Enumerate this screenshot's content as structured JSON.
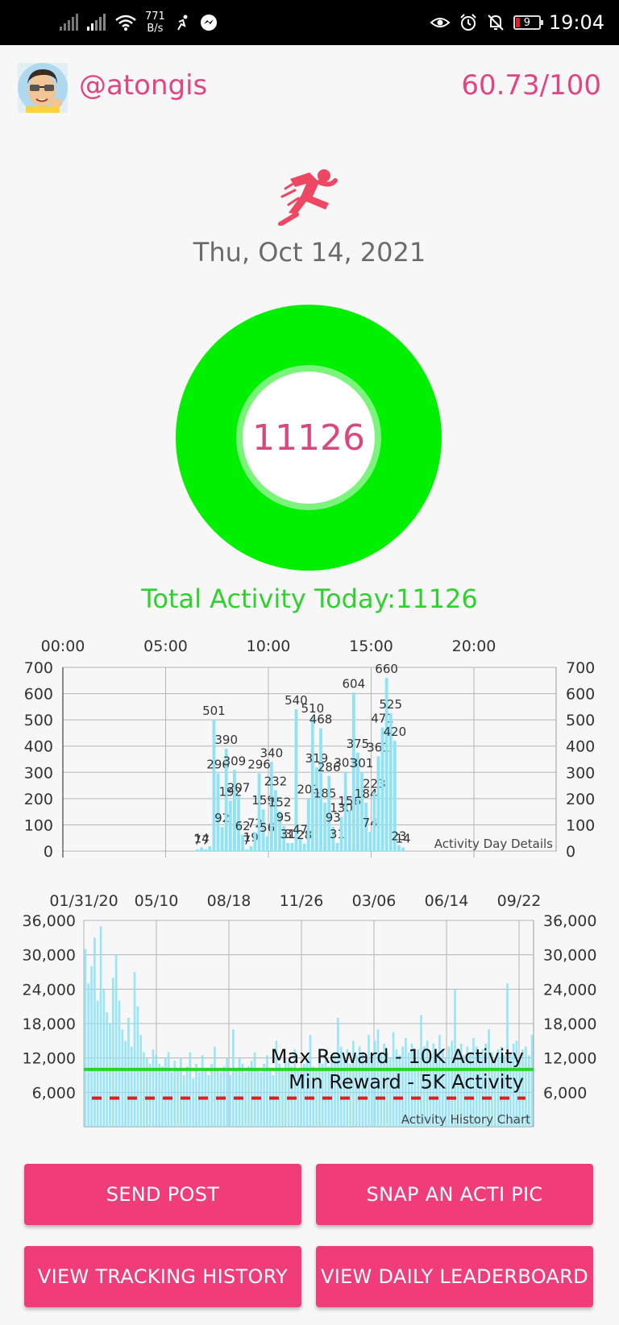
{
  "status_bar": {
    "net_speed_value": "771",
    "net_speed_unit": "B/s",
    "battery_level": "9",
    "time": "19:04"
  },
  "header": {
    "username": "@atongis",
    "score": "60.73/100"
  },
  "date": "Thu, Oct 14, 2021",
  "activity_ring": {
    "value": "11126",
    "ring_color": "#00f000",
    "inner_ring_color": "#7bf47b"
  },
  "total_activity_text": "Total Activity Today:11126",
  "colors": {
    "accent_pink": "#e2457f",
    "button_pink": "#f03c79",
    "bar_blue": "#8fe3f7",
    "max_line_green": "#22d822",
    "min_line_red": "#d82020"
  },
  "chart_data": [
    {
      "type": "bar",
      "caption": "Activity Day Details",
      "x_tick_labels": [
        "00:00",
        "05:00",
        "10:00",
        "15:00",
        "20:00"
      ],
      "x_tick_hours": [
        0,
        5,
        10,
        15,
        20
      ],
      "xlim_hours": [
        0,
        24
      ],
      "ylim": [
        0,
        700
      ],
      "y_ticks": [
        0,
        100,
        200,
        300,
        400,
        500,
        600,
        700
      ],
      "grid": true,
      "bars": [
        {
          "hour": 6.55,
          "value": 7,
          "label": "7"
        },
        {
          "hour": 6.75,
          "value": 14,
          "label": "14"
        },
        {
          "hour": 6.95,
          "value": 7,
          "label": "7"
        },
        {
          "hour": 7.15,
          "value": 18,
          "label": ""
        },
        {
          "hour": 7.35,
          "value": 501,
          "label": "501"
        },
        {
          "hour": 7.55,
          "value": 296,
          "label": "296"
        },
        {
          "hour": 7.75,
          "value": 92,
          "label": "92"
        },
        {
          "hour": 7.95,
          "value": 390,
          "label": "390"
        },
        {
          "hour": 8.15,
          "value": 192,
          "label": "192"
        },
        {
          "hour": 8.35,
          "value": 309,
          "label": "309"
        },
        {
          "hour": 8.55,
          "value": 207,
          "label": "207"
        },
        {
          "hour": 8.75,
          "value": 62,
          "label": "62"
        },
        {
          "hour": 8.95,
          "value": 7,
          "label": "7"
        },
        {
          "hour": 9.15,
          "value": 19,
          "label": "19"
        },
        {
          "hour": 9.35,
          "value": 72,
          "label": "72"
        },
        {
          "hour": 9.55,
          "value": 296,
          "label": "296"
        },
        {
          "hour": 9.75,
          "value": 159,
          "label": "159"
        },
        {
          "hour": 9.95,
          "value": 56,
          "label": "56"
        },
        {
          "hour": 10.15,
          "value": 340,
          "label": "340"
        },
        {
          "hour": 10.35,
          "value": 232,
          "label": "232"
        },
        {
          "hour": 10.55,
          "value": 152,
          "label": "152"
        },
        {
          "hour": 10.75,
          "value": 95,
          "label": "95"
        },
        {
          "hour": 10.95,
          "value": 31,
          "label": "31"
        },
        {
          "hour": 11.15,
          "value": 31,
          "label": "31"
        },
        {
          "hour": 11.35,
          "value": 540,
          "label": "540"
        },
        {
          "hour": 11.55,
          "value": 47,
          "label": "47"
        },
        {
          "hour": 11.75,
          "value": 28,
          "label": "28"
        },
        {
          "hour": 11.95,
          "value": 201,
          "label": "201"
        },
        {
          "hour": 12.15,
          "value": 510,
          "label": "510"
        },
        {
          "hour": 12.35,
          "value": 319,
          "label": "319"
        },
        {
          "hour": 12.55,
          "value": 468,
          "label": "468"
        },
        {
          "hour": 12.75,
          "value": 185,
          "label": "185"
        },
        {
          "hour": 12.95,
          "value": 286,
          "label": "286"
        },
        {
          "hour": 13.15,
          "value": 93,
          "label": "93"
        },
        {
          "hour": 13.35,
          "value": 31,
          "label": "31"
        },
        {
          "hour": 13.55,
          "value": 130,
          "label": "130"
        },
        {
          "hour": 13.75,
          "value": 303,
          "label": "303"
        },
        {
          "hour": 13.95,
          "value": 156,
          "label": "156"
        },
        {
          "hour": 14.15,
          "value": 604,
          "label": "604"
        },
        {
          "hour": 14.35,
          "value": 375,
          "label": "375"
        },
        {
          "hour": 14.55,
          "value": 301,
          "label": "301"
        },
        {
          "hour": 14.75,
          "value": 184,
          "label": "184"
        },
        {
          "hour": 14.95,
          "value": 74,
          "label": "74"
        },
        {
          "hour": 15.15,
          "value": 223,
          "label": "223"
        },
        {
          "hour": 15.35,
          "value": 361,
          "label": "361"
        },
        {
          "hour": 15.55,
          "value": 471,
          "label": "471"
        },
        {
          "hour": 15.75,
          "value": 660,
          "label": "660"
        },
        {
          "hour": 15.95,
          "value": 525,
          "label": "525"
        },
        {
          "hour": 16.15,
          "value": 420,
          "label": "420"
        },
        {
          "hour": 16.35,
          "value": 23,
          "label": "23"
        },
        {
          "hour": 16.55,
          "value": 14,
          "label": "14"
        }
      ]
    },
    {
      "type": "bar",
      "caption": "Activity History Chart",
      "x_tick_labels": [
        "01/31/20",
        "05/10",
        "08/18",
        "11/26",
        "03/06",
        "06/14",
        "09/22"
      ],
      "x_days_span": [
        0,
        620
      ],
      "x_tick_days": [
        0,
        100,
        200,
        300,
        400,
        500,
        600
      ],
      "ylim": [
        0,
        36000
      ],
      "y_ticks": [
        6000,
        12000,
        18000,
        24000,
        30000,
        36000
      ],
      "y_tick_labels": [
        "6,000",
        "12,000",
        "18,000",
        "24,000",
        "30,000",
        "36,000"
      ],
      "grid": true,
      "reference_lines": [
        {
          "label": "Max Reward - 10K Activity",
          "value": 10000,
          "color": "#22d822",
          "style": "solid"
        },
        {
          "label": "Min Reward - 5K Activity",
          "value": 5000,
          "color": "#d82020",
          "style": "dashed"
        }
      ],
      "daily_values": [
        31000,
        25000,
        28000,
        33000,
        22000,
        35000,
        24000,
        20000,
        18000,
        26000,
        30000,
        22000,
        17000,
        15000,
        19000,
        14000,
        27000,
        21000,
        16000,
        13000,
        12000,
        11000,
        13500,
        12500,
        11000,
        10500,
        12000,
        13000,
        9500,
        11500,
        10000,
        12000,
        9000,
        10500,
        13000,
        8500,
        11000,
        9500,
        12500,
        10000,
        9000,
        11000,
        14000,
        10000,
        9500,
        10500,
        12000,
        9000,
        17000,
        10000,
        12000,
        11000,
        9500,
        10500,
        11500,
        13000,
        10000,
        9500,
        11000,
        12500,
        10000,
        9000,
        15000,
        11000,
        10000,
        12000,
        11500,
        10500,
        13500,
        10000,
        9500,
        11000,
        12000,
        16000,
        10500,
        10000,
        12000,
        11000,
        13000,
        10500,
        11500,
        12500,
        19000,
        14000,
        12000,
        13500,
        11000,
        15000,
        12500,
        14000,
        13000,
        11500,
        16000,
        12000,
        15000,
        17000,
        12500,
        14500,
        13000,
        12000,
        16500,
        13500,
        12500,
        14000,
        15500,
        13000,
        14500,
        12000,
        13500,
        19500,
        14000,
        15000,
        12500,
        14500,
        13000,
        16000,
        13500,
        12000,
        14000,
        15000,
        24000,
        13000,
        14500,
        12500,
        14000,
        13000,
        15500,
        14000,
        12500,
        13500,
        14500,
        17000,
        13000,
        12000,
        13500,
        14000,
        12500,
        25000,
        13000,
        14500,
        15000,
        12000,
        13500,
        14000,
        12500,
        16000
      ]
    }
  ],
  "buttons": {
    "send_post": "SEND POST",
    "snap_pic": "SNAP AN ACTI PIC",
    "tracking_history": "VIEW TRACKING HISTORY",
    "daily_leaderboard": "VIEW DAILY LEADERBOARD"
  }
}
